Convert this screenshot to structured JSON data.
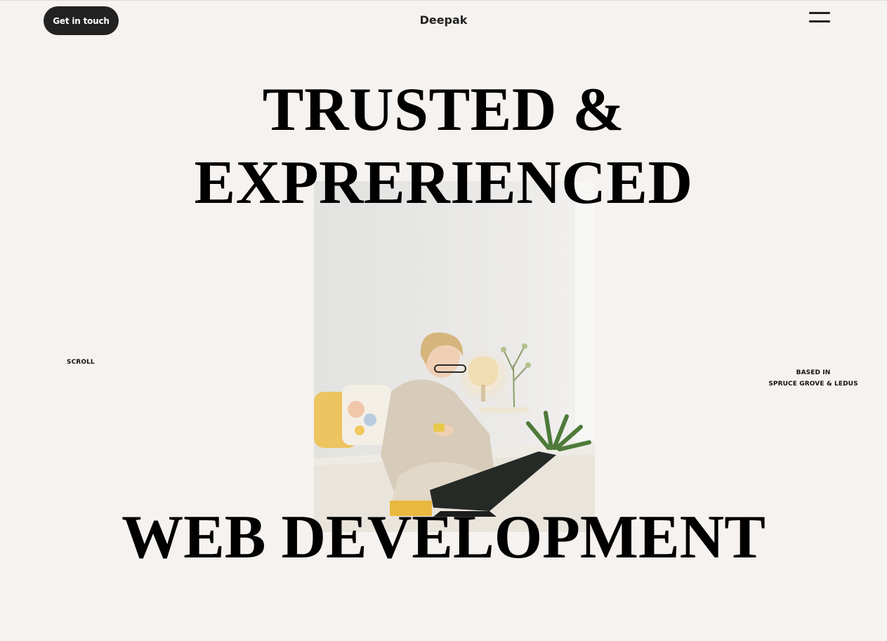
{
  "header": {
    "cta_label": "Get in touch",
    "brand": "Deepak",
    "menu_icon": "hamburger-menu-icon"
  },
  "hero": {
    "line1": "TRUSTED &",
    "line2": "EXPRERIENCED",
    "line3": "WEB DEVELOPMENT",
    "scroll_label": "SCROLL",
    "location_label": "BASED IN",
    "location": "SPRUCE GROVE & LEDUS"
  },
  "colors": {
    "background": "#f6f2ef",
    "button": "#222222",
    "text": "#000000"
  }
}
